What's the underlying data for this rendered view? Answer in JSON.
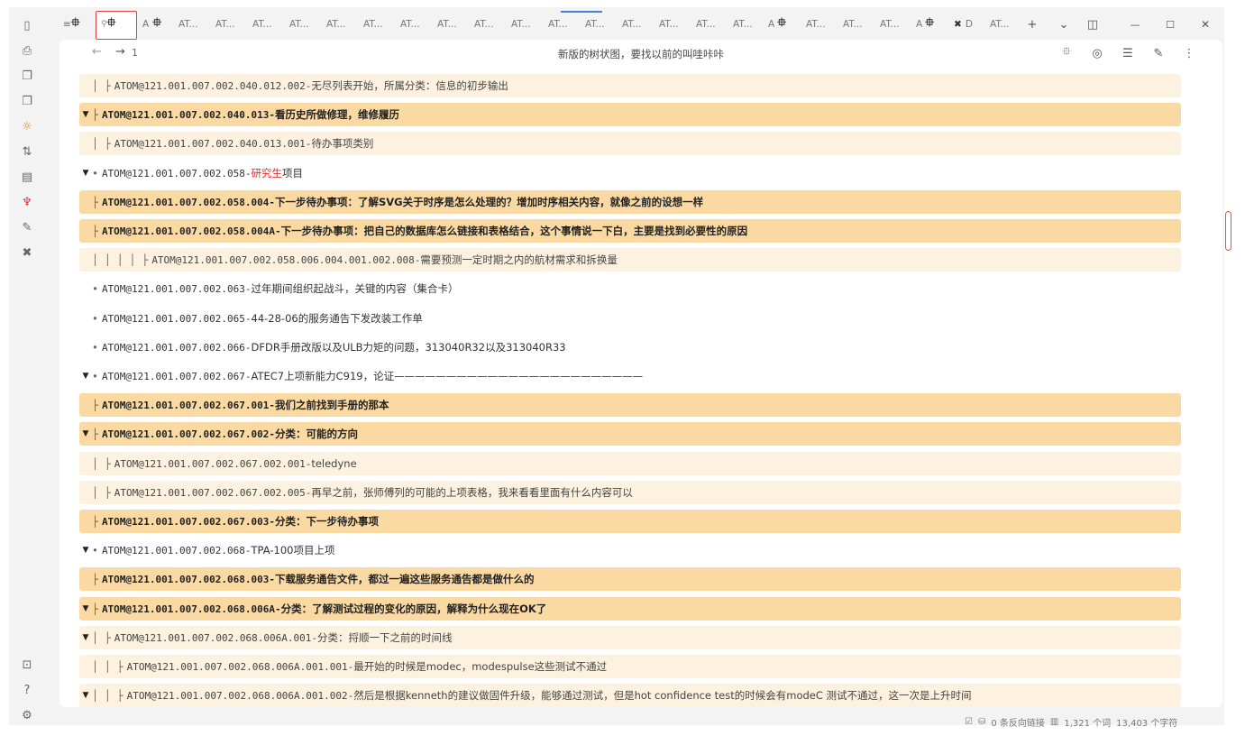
{
  "ribbon": {
    "top_icons": [
      "sidebar-toggle-icon",
      "file-icon",
      "copy-icon",
      "copy-icon",
      "sun-icon",
      "sort-icon",
      "archive-icon",
      "plugin-icon",
      "puzzle-icon",
      "tools-icon"
    ],
    "top_glyphs": [
      "▯",
      "⎙",
      "❐",
      "❐",
      "☼",
      "⇅",
      "▤",
      "♆",
      "✎",
      "✖"
    ],
    "bottom_glyphs": [
      "⊡",
      "?",
      "⚙"
    ]
  },
  "tabs": {
    "items": [
      {
        "label": "AT..."
      },
      {
        "label": "AT..."
      },
      {
        "label": "AT..."
      },
      {
        "label": "AT..."
      },
      {
        "label": "AT..."
      },
      {
        "label": "AT..."
      },
      {
        "label": "AT..."
      },
      {
        "label": "AT..."
      },
      {
        "label": "AT..."
      },
      {
        "label": "AT..."
      },
      {
        "label": "AT..."
      },
      {
        "label": "AT..."
      },
      {
        "label": "AT..."
      },
      {
        "label": "AT..."
      },
      {
        "label": "AT..."
      },
      {
        "label": "AT..."
      },
      {
        "label": "AT..."
      },
      {
        "label": "AT..."
      }
    ],
    "short_a": "A",
    "short_d": "D",
    "pin_glyph": "⯐",
    "new_tab": "+",
    "dropdown": "⌄",
    "min": "—",
    "max": "☐",
    "close": "✕"
  },
  "view": {
    "title": "新版的树状图，要找以前的叫哇咔咔",
    "back": "←",
    "forward": "→",
    "count": "1"
  },
  "rows": [
    {
      "style": "light",
      "caret": "",
      "prefix": "│ ├",
      "atom": "ATOM@121.001.007.002.040.012.002-",
      "desc": " 无尽列表开始，所属分类：信息的初步输出"
    },
    {
      "style": "strong",
      "caret": "▼",
      "prefix": "├",
      "atom": "ATOM@121.001.007.002.040.013-",
      "desc": " 看历史所做修理，维修履历"
    },
    {
      "style": "light",
      "caret": "",
      "prefix": "│ ├",
      "atom": "ATOM@121.001.007.002.040.013.001-",
      "desc": " 待办事项类别"
    },
    {
      "style": "none",
      "caret": "▼",
      "prefix": "•",
      "atom": "ATOM@121.001.007.002.058-",
      "desc_red": "研究生",
      "desc": "项目"
    },
    {
      "style": "strong",
      "caret": "",
      "prefix": "├",
      "atom": "ATOM@121.001.007.002.058.004-",
      "desc": " 下一步待办事项：了解SVG关于时序是怎么处理的？增加时序相关内容，就像之前的设想一样"
    },
    {
      "style": "strong",
      "caret": "",
      "prefix": "├",
      "atom": "ATOM@121.001.007.002.058.004A-",
      "desc": " 下一步待办事项：把自己的数据库怎么链接和表格结合，这个事情说一下白，主要是找到必要性的原因"
    },
    {
      "style": "light",
      "caret": "",
      "prefix": "│ │ │ │ ├",
      "atom": "ATOM@121.001.007.002.058.006.004.001.002.008-",
      "desc": " 需要预测一定时期之内的航材需求和拆换量"
    },
    {
      "style": "none",
      "caret": "",
      "prefix": "•",
      "atom": "ATOM@121.001.007.002.063-",
      "desc": " 过年期间组织起战斗，关键的内容（集合卡）"
    },
    {
      "style": "none",
      "caret": "",
      "prefix": "•",
      "atom": "ATOM@121.001.007.002.065-",
      "desc": " 44-28-06的服务通告下发改装工作单"
    },
    {
      "style": "none",
      "caret": "",
      "prefix": "•",
      "atom": "ATOM@121.001.007.002.066-",
      "desc": " DFDR手册改版以及ULB力矩的问题，313040R32以及313040R33"
    },
    {
      "style": "none",
      "caret": "▼",
      "prefix": "•",
      "atom": "ATOM@121.001.007.002.067-",
      "desc": " ATEC7上项新能力C919，论证————————————————————————"
    },
    {
      "style": "strong",
      "caret": "",
      "prefix": "├",
      "atom": "ATOM@121.001.007.002.067.001-",
      "desc": " 我们之前找到手册的那本"
    },
    {
      "style": "strong",
      "caret": "▼",
      "prefix": "├",
      "atom": "ATOM@121.001.007.002.067.002-",
      "desc": " 分类：可能的方向"
    },
    {
      "style": "light",
      "caret": "",
      "prefix": "│ ├",
      "atom": "ATOM@121.001.007.002.067.002.001-",
      "desc": " teledyne"
    },
    {
      "style": "light",
      "caret": "",
      "prefix": "│ ├",
      "atom": "ATOM@121.001.007.002.067.002.005-",
      "desc": " 再早之前，张师傅列的可能的上项表格，我来看看里面有什么内容可以"
    },
    {
      "style": "strong",
      "caret": "",
      "prefix": "├",
      "atom": "ATOM@121.001.007.002.067.003-",
      "desc": " 分类：下一步待办事项"
    },
    {
      "style": "none",
      "caret": "▼",
      "prefix": "•",
      "atom": "ATOM@121.001.007.002.068-",
      "desc": " TPA-100项目上项"
    },
    {
      "style": "strong",
      "caret": "",
      "prefix": "├",
      "atom": "ATOM@121.001.007.002.068.003-",
      "desc": " 下载服务通告文件，都过一遍这些服务通告都是做什么的"
    },
    {
      "style": "strong",
      "caret": "▼",
      "prefix": "├",
      "atom": "ATOM@121.001.007.002.068.006A-",
      "desc": " 分类：了解测试过程的变化的原因，解释为什么现在OK了"
    },
    {
      "style": "light",
      "caret": "▼",
      "prefix": "│ ├",
      "atom": "ATOM@121.001.007.002.068.006A.001-",
      "desc": " 分类：捋顺一下之前的时间线"
    },
    {
      "style": "light",
      "caret": "",
      "prefix": "│ │ ├",
      "atom": "ATOM@121.001.007.002.068.006A.001.001-",
      "desc": " 最开始的时候是modec，modespulse这些测试不通过"
    },
    {
      "style": "light",
      "caret": "▼",
      "prefix": "│ │ ├",
      "atom": "ATOM@121.001.007.002.068.006A.001.002-",
      "desc": " 然后是根据kenneth的建议做固件升级，能够通过测试，但是hot confidence test的时候会有modeC 测试不通过，这一次是上升时间"
    }
  ],
  "status": {
    "backlinks": "0 条反向链接",
    "words": "1,321 个词",
    "chars": "13,403 个字符"
  }
}
